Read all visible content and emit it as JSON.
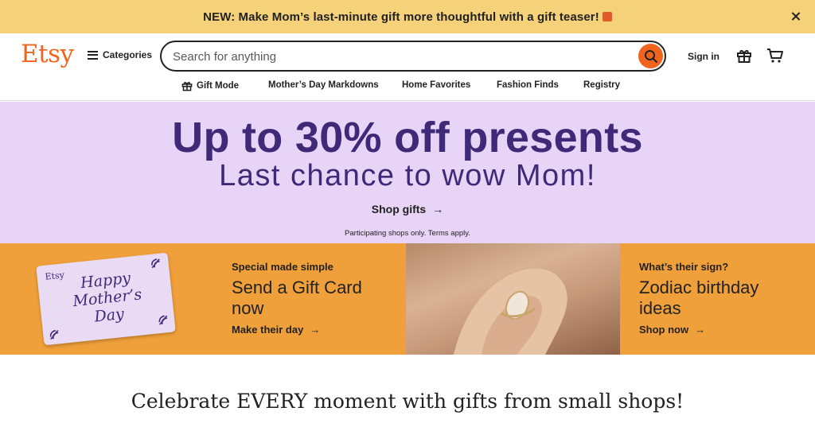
{
  "banner": {
    "text": "NEW: Make Mom’s last-minute gift more thoughtful with a gift teaser!",
    "gift_icon": "gift-emoji-icon",
    "close_icon": "close-icon"
  },
  "header": {
    "logo": "Etsy",
    "categories_label": "Categories",
    "search": {
      "placeholder": "Search for anything",
      "value": ""
    },
    "sign_in": "Sign in",
    "icons": [
      "search-icon",
      "gift-icon",
      "cart-icon"
    ]
  },
  "nav": {
    "items": [
      {
        "label": "Gift Mode",
        "icon": "gift-icon"
      },
      {
        "label": "Mother’s Day Markdowns"
      },
      {
        "label": "Home Favorites"
      },
      {
        "label": "Fashion Finds"
      },
      {
        "label": "Registry"
      }
    ]
  },
  "hero": {
    "headline": "Up to 30% off presents",
    "subheadline": "Last chance to wow Mom!",
    "cta": "Shop gifts",
    "fine_print": "Participating shops only. Terms apply."
  },
  "promo": {
    "gift_card": {
      "brand": "Etsy",
      "script": "Happy Mother’s Day"
    },
    "left": {
      "eyebrow": "Special made simple",
      "title": "Send a Gift Card now",
      "cta": "Make their day"
    },
    "right": {
      "eyebrow": "What’s their sign?",
      "title": "Zodiac birthday ideas",
      "cta": "Shop now"
    }
  },
  "tagline": "Celebrate EVERY moment with gifts from small shops!",
  "colors": {
    "brand_orange": "#f1641e",
    "banner_yellow": "#f5d27a",
    "hero_lavender": "#e7d4f7",
    "hero_purple": "#3f2a78",
    "promo_orange": "#f0a03a"
  }
}
